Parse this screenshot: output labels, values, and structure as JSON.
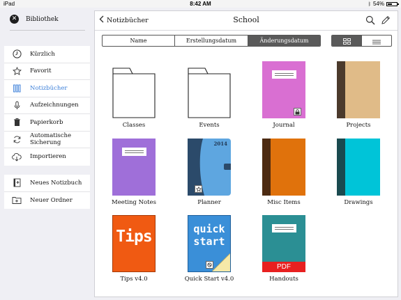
{
  "status": {
    "device": "iPad",
    "time": "8:42 AM",
    "battery": "54%",
    "battery_level": 0.54
  },
  "sidebar": {
    "library_label": "Bibliothek",
    "items": [
      {
        "label": "Kürzlich",
        "icon": "clock-icon",
        "active": false
      },
      {
        "label": "Favorit",
        "icon": "star-icon",
        "active": false
      },
      {
        "label": "Notizbücher",
        "icon": "notebooks-icon",
        "active": true
      },
      {
        "label": "Aufzeichnungen",
        "icon": "microphone-icon",
        "active": false
      },
      {
        "label": "Papierkorb",
        "icon": "trash-icon",
        "active": false
      },
      {
        "label": "Automatische Sicherung",
        "icon": "sync-icon",
        "active": false
      },
      {
        "label": "Importieren",
        "icon": "cloud-download-icon",
        "active": false
      }
    ],
    "actions": [
      {
        "label": "Neues Notizbuch",
        "icon": "new-notebook-icon"
      },
      {
        "label": "Neuer Ordner",
        "icon": "new-folder-icon"
      }
    ]
  },
  "header": {
    "back_label": "Notizbücher",
    "title": "School"
  },
  "sort": {
    "options": [
      "Name",
      "Erstellungsdatum",
      "Änderungsdatum"
    ],
    "selected": "Änderungsdatum"
  },
  "view_mode": {
    "selected": "grid"
  },
  "items": [
    {
      "name": "Classes",
      "type": "folder"
    },
    {
      "name": "Events",
      "type": "folder"
    },
    {
      "name": "Journal",
      "type": "notebook",
      "color": "#d96fd2",
      "style": "plain-locked"
    },
    {
      "name": "Projects",
      "type": "notebook",
      "color": "#e0bb88",
      "spine": "#4b3a2c"
    },
    {
      "name": "Meeting Notes",
      "type": "notebook",
      "color": "#9f6fd9",
      "style": "plain"
    },
    {
      "name": "Planner",
      "type": "notebook",
      "color": "#5ea6e0",
      "spine": "#2b4a6a",
      "year": "2014",
      "style": "planner"
    },
    {
      "name": "Misc Items",
      "type": "notebook",
      "color": "#e0720c",
      "spine": "#4d2b12"
    },
    {
      "name": "Drawings",
      "type": "notebook",
      "color": "#00c4d8",
      "spine": "#1a4a4f"
    },
    {
      "name": "Tips v4.0",
      "type": "notebook",
      "color": "#f05a12",
      "style": "tips",
      "cover_text": "Tips"
    },
    {
      "name": "Quick Start v4.0",
      "type": "notebook",
      "color": "#3a8fd8",
      "style": "quickstart",
      "cover_text_1": "quick",
      "cover_text_2": "start"
    },
    {
      "name": "Handouts",
      "type": "notebook",
      "color": "#2b8f94",
      "style": "pdf",
      "badge": "PDF",
      "badge_color": "#e82020"
    }
  ]
}
